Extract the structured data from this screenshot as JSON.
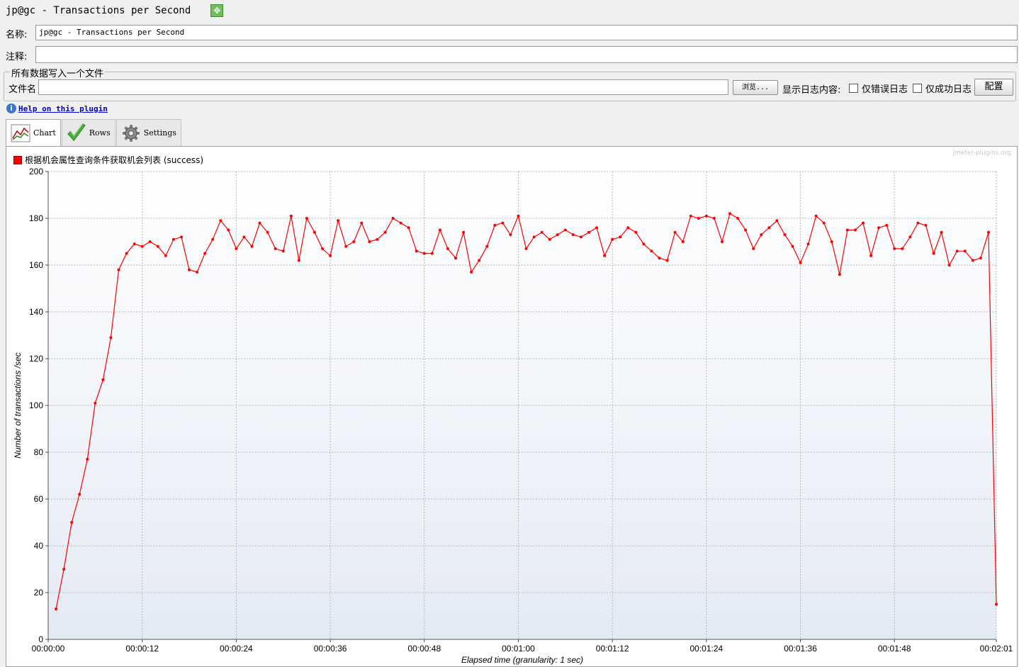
{
  "window": {
    "title": "jp@gc - Transactions per Second",
    "title_icon": "expand-arrows-icon"
  },
  "form": {
    "name_label": "名称:",
    "name_value": "jp@gc - Transactions per Second",
    "comment_label": "注释:",
    "comment_value": "",
    "group_title": "所有数据写入一个文件",
    "file_label": "文件名",
    "file_value": "",
    "browse_label": "浏览...",
    "log_content_label": "显示日志内容:",
    "errors_only_label": "仅错误日志",
    "success_only_label": "仅成功日志",
    "configure_label": "配置"
  },
  "help": {
    "link_text": "Help on this plugin"
  },
  "tabs": [
    {
      "label": "Chart",
      "icon": "line-chart-icon",
      "active": true
    },
    {
      "label": "Rows",
      "icon": "checkmark-icon",
      "active": false
    },
    {
      "label": "Settings",
      "icon": "gear-icon",
      "active": false
    }
  ],
  "chart_data": {
    "type": "line",
    "watermark": "jmeter-plugins.org",
    "xlabel": "Elapsed time (granularity: 1 sec)",
    "ylabel": "Number of transactions /sec",
    "ylim": [
      0,
      200
    ],
    "yticks": [
      0,
      20,
      40,
      60,
      80,
      100,
      120,
      140,
      160,
      180,
      200
    ],
    "xlim_seconds": [
      0,
      121
    ],
    "xtick_labels": [
      "00:00:00",
      "00:00:12",
      "00:00:24",
      "00:00:36",
      "00:00:48",
      "00:01:00",
      "00:01:12",
      "00:01:24",
      "00:01:36",
      "00:01:48",
      "00:02:01"
    ],
    "grid": true,
    "legend_position": "top-left",
    "series": [
      {
        "name": "根据机会属性查询条件获取机会列表 (success)",
        "color": "#ff0000",
        "values": [
          13,
          30,
          50,
          62,
          77,
          101,
          111,
          129,
          158,
          165,
          169,
          168,
          170,
          168,
          164,
          171,
          172,
          158,
          157,
          165,
          171,
          179,
          175,
          167,
          172,
          168,
          178,
          174,
          167,
          166,
          181,
          162,
          180,
          174,
          167,
          164,
          179,
          168,
          170,
          178,
          170,
          171,
          174,
          180,
          178,
          176,
          166,
          165,
          165,
          175,
          167,
          163,
          174,
          157,
          162,
          168,
          177,
          178,
          173,
          181,
          167,
          172,
          174,
          171,
          173,
          175,
          173,
          172,
          174,
          176,
          164,
          171,
          172,
          176,
          174,
          169,
          166,
          163,
          162,
          174,
          170,
          181,
          180,
          181,
          180,
          170,
          182,
          180,
          175,
          167,
          173,
          176,
          179,
          173,
          168,
          161,
          169,
          181,
          178,
          170,
          156,
          175,
          175,
          178,
          164,
          176,
          177,
          167,
          167,
          172,
          178,
          177,
          165,
          174,
          160,
          166,
          166,
          162,
          163,
          174,
          15
        ]
      }
    ]
  }
}
